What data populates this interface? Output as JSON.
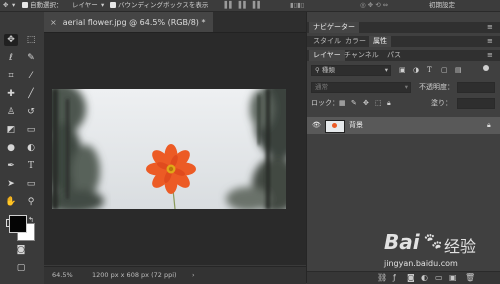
{
  "options_bar": {
    "auto_select_label": "自動選択：",
    "auto_select_value": "レイヤー",
    "show_transform_label": "バウンディングボックスを表示",
    "essentials_label": "初期設定"
  },
  "document": {
    "tab_title": "aerial flower.jpg @ 64.5% (RGB/8) *"
  },
  "status_bar": {
    "zoom": "64.5%",
    "doc_info": "1200 px x 608 px (72 ppi)"
  },
  "panels": {
    "navigator_tab": "ナビゲーター",
    "style_tab": "スタイル",
    "color_tab": "カラー",
    "properties_tab": "属性",
    "layers_tab": "レイヤー",
    "channels_tab": "チャンネル",
    "paths_tab": "パス",
    "filter_kind_value": "種類",
    "blend_mode_value": "通常",
    "opacity_label": "不透明度：",
    "lock_label": "ロック：",
    "fill_label": "塗り：",
    "layer_name": "背景"
  },
  "watermark": {
    "brand": "Bai",
    "brand_suffix": "经验",
    "url": "jingyan.baidu.com"
  }
}
